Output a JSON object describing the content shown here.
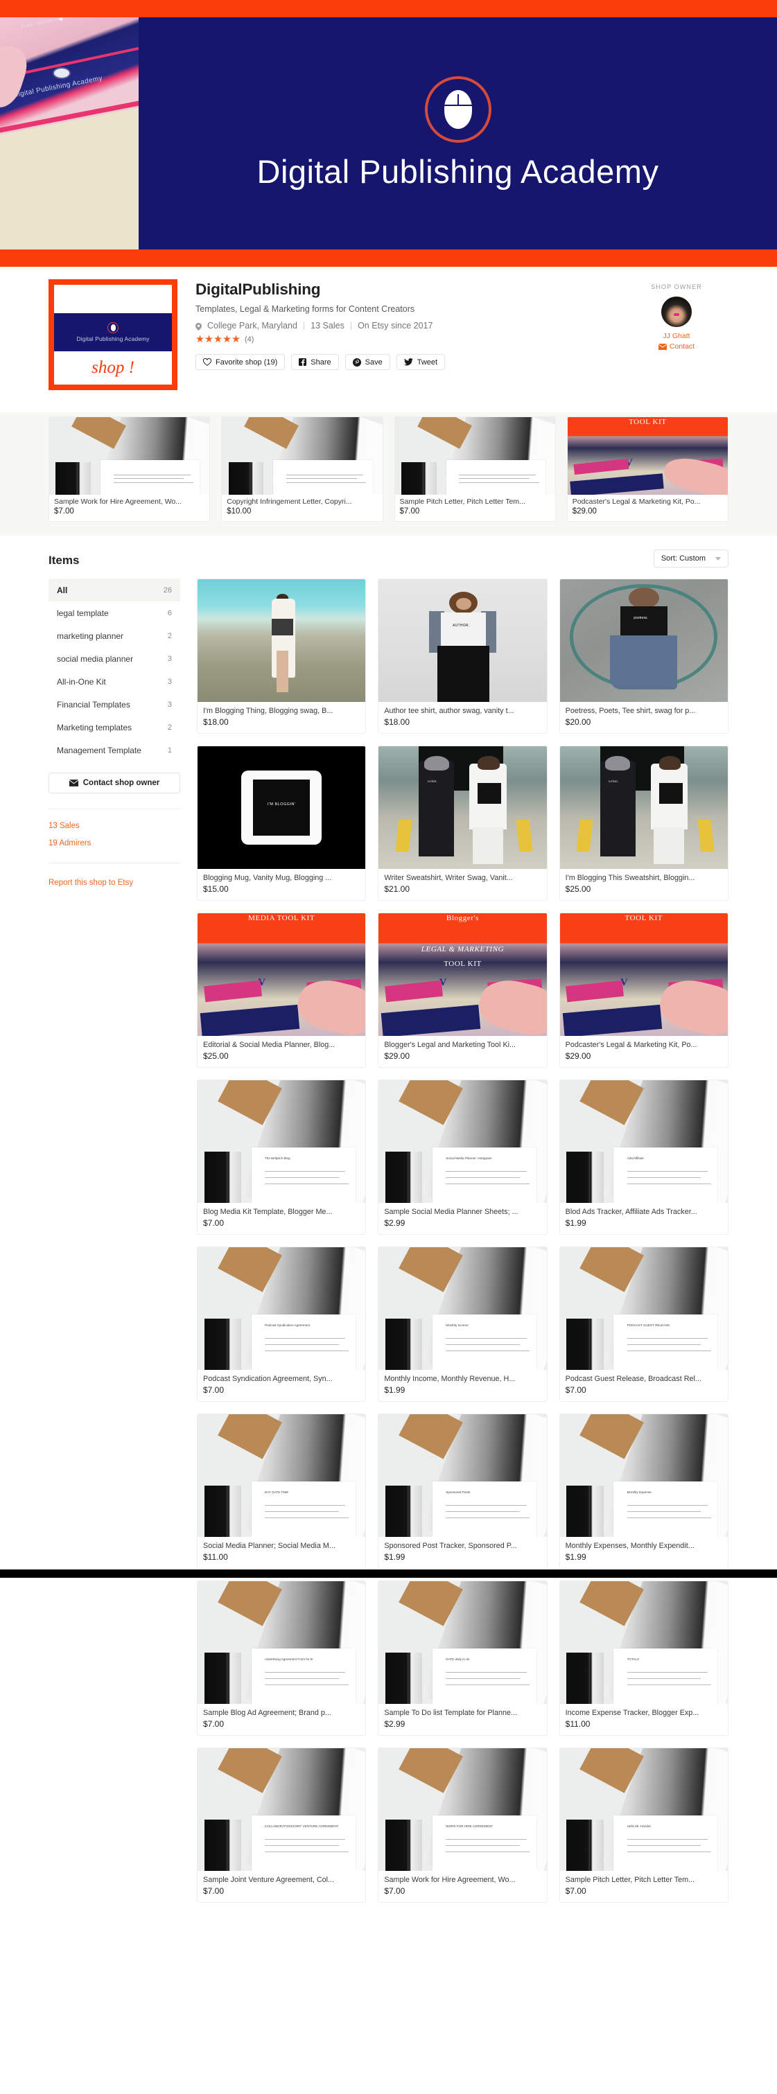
{
  "banner": {
    "title": "Digital Publishing Academy",
    "accent_red": "#fa3c0a",
    "navy": "#16166e",
    "logo_caption": "Digital Publishing Academy",
    "logo_shop_word": "shop !",
    "photo_caption": "Digital Publishing Academy"
  },
  "shop": {
    "name": "DigitalPublishing",
    "tagline": "Templates, Legal & Marketing forms for Content Creators",
    "location": "College Park, Maryland",
    "sales": "13 Sales",
    "since": "On Etsy since 2017",
    "stars": "★★★★★",
    "rating_count": "(4)",
    "buttons": {
      "favorite": "Favorite shop (19)",
      "share": "Share",
      "save": "Save",
      "tweet": "Tweet"
    }
  },
  "owner": {
    "label": "SHOP OWNER",
    "name": "JJ Ghatt",
    "contact": "Contact"
  },
  "featured": [
    {
      "title": "Sample Work for Hire Agreement, Wo...",
      "price": "$7.00",
      "art": "doc"
    },
    {
      "title": "Copyright Infringement Letter, Copyri...",
      "price": "$10.00",
      "art": "doc"
    },
    {
      "title": "Sample Pitch Letter, Pitch Letter Tem...",
      "price": "$7.00",
      "art": "doc"
    },
    {
      "title": "Podcaster's Legal & Marketing Kit, Po...",
      "price": "$29.00",
      "art": "kit",
      "kit_title": "TOOL KIT"
    }
  ],
  "items_section": {
    "heading": "Items",
    "sort_label": "Sort: Custom"
  },
  "sidebar": {
    "categories": [
      {
        "label": "All",
        "count": "26",
        "active": true
      },
      {
        "label": "legal template",
        "count": "6",
        "active": false
      },
      {
        "label": "marketing planner",
        "count": "2",
        "active": false
      },
      {
        "label": "social media planner",
        "count": "3",
        "active": false
      },
      {
        "label": "All-in-One Kit",
        "count": "3",
        "active": false
      },
      {
        "label": "Financial Templates",
        "count": "3",
        "active": false
      },
      {
        "label": "Marketing templates",
        "count": "2",
        "active": false
      },
      {
        "label": "Management Template",
        "count": "1",
        "active": false
      }
    ],
    "contact_button": "Contact shop owner",
    "sales_link": "13 Sales",
    "admirers_link": "19 Admirers",
    "report_link": "Report this shop to Etsy"
  },
  "items": [
    {
      "title": "I'm Blogging Thing, Blogging swag, B...",
      "price": "$18.00",
      "art": "beach"
    },
    {
      "title": "Author tee shirt, author swag, vanity t...",
      "price": "$18.00",
      "art": "grey",
      "shirt_word": "AUTHOR."
    },
    {
      "title": "Poetress, Poets, Tee shirt, swag for p...",
      "price": "$20.00",
      "art": "pave",
      "shirt_word": "poetress."
    },
    {
      "title": "Blogging Mug, Vanity Mug, Blogging ...",
      "price": "$15.00",
      "art": "mug",
      "mug_word": "I'M BLOGGIN'"
    },
    {
      "title": "Writer Sweatshirt, Writer Swag, Vanit...",
      "price": "$21.00",
      "art": "alley",
      "shirt_word": "writer."
    },
    {
      "title": "I'm Blogging This Sweatshirt, Bloggin...",
      "price": "$25.00",
      "art": "alley",
      "shirt_word": "writer."
    },
    {
      "title": "Editorial & Social Media Planner, Blog...",
      "price": "$25.00",
      "art": "kit",
      "kit_title": "MEDIA TOOL KIT"
    },
    {
      "title": "Blogger's Legal and Marketing Tool Ki...",
      "price": "$29.00",
      "art": "kit2",
      "kit_title": "Blogger's",
      "kit_sub": "LEGAL & MARKETING",
      "kit_sub2": "TOOL KIT"
    },
    {
      "title": "Podcaster's Legal & Marketing Kit, Po...",
      "price": "$29.00",
      "art": "kit",
      "kit_title": "TOOL KIT"
    },
    {
      "title": "Blog Media Kit Template, Blogger Me...",
      "price": "$7.00",
      "art": "doc",
      "doc_label": "The Bellyitch Blog"
    },
    {
      "title": "Sample Social Media Planner Sheets; ...",
      "price": "$2.99",
      "art": "doc",
      "doc_label": "Social Media Planner: Instagram"
    },
    {
      "title": "Blod Ads Tracker, Affiliate Ads Tracker...",
      "price": "$1.99",
      "art": "doc",
      "doc_label": "Ads/Affiliate"
    },
    {
      "title": "Podcast Syndication Agreement, Syn...",
      "price": "$7.00",
      "art": "doc",
      "doc_label": "Podcast Syndication Agreement"
    },
    {
      "title": "Monthly Income, Monthly Revenue, H...",
      "price": "$1.99",
      "art": "doc",
      "doc_label": "Monthly Income"
    },
    {
      "title": "Podcast Guest Release, Broadcast Rel...",
      "price": "$7.00",
      "art": "doc",
      "doc_label": "PODCAST GUEST RELEASE"
    },
    {
      "title": "Social Media Planner; Social Media M...",
      "price": "$11.00",
      "art": "doc",
      "doc_label": "DAY  DATE  TIME"
    },
    {
      "title": "Sponsored Post Tracker, Sponsored P...",
      "price": "$1.99",
      "art": "doc",
      "doc_label": "Sponsored Posts"
    },
    {
      "title": "Monthly Expenses, Monthly Expendit...",
      "price": "$1.99",
      "art": "doc",
      "doc_label": "Monthly Expense"
    },
    {
      "title": "Sample Blog Ad Agreement; Brand p...",
      "price": "$7.00",
      "art": "doc",
      "doc_label": "Advertising Agreement Form for B"
    },
    {
      "title": "Sample To Do list Template for Planne...",
      "price": "$2.99",
      "art": "doc",
      "doc_label": "DATE     daily to do"
    },
    {
      "title": "Income Expense Tracker, Blogger Exp...",
      "price": "$11.00",
      "art": "doc",
      "doc_label": "TOTALS"
    },
    {
      "title": "Sample Joint Venture Agreement, Col...",
      "price": "$7.00",
      "art": "doc",
      "doc_label": "COLLABORATION/JOINT VENTURE AGREEMENT"
    },
    {
      "title": "Sample Work for Hire Agreement, Wo...",
      "price": "$7.00",
      "art": "doc",
      "doc_label": "WORK FOR HIRE AGREEMENT"
    },
    {
      "title": "Sample Pitch Letter, Pitch Letter Tem...",
      "price": "$7.00",
      "art": "doc",
      "doc_label": "Hello Mr. Handel,"
    }
  ]
}
